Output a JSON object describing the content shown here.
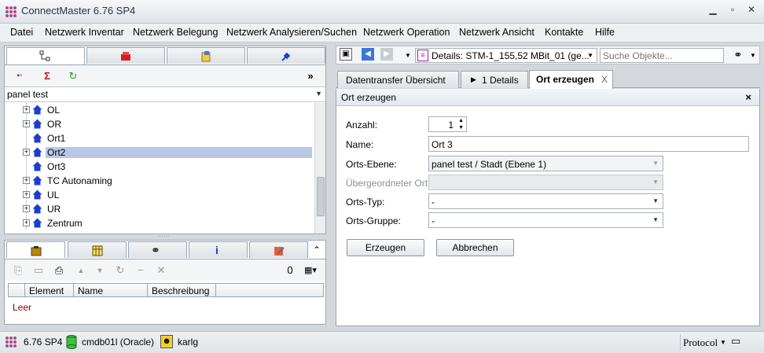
{
  "app": {
    "title": "ConnectMaster 6.76 SP4"
  },
  "menu": [
    "Datei",
    "Netzwerk Inventar",
    "Netzwerk Belegung",
    "Netzwerk Analysieren/Suchen",
    "Netzwerk Operation",
    "Netzwerk Ansicht",
    "Kontakte",
    "Hilfe"
  ],
  "left": {
    "toolbar": {
      "more": "»"
    },
    "dropdown": "panel test",
    "tree": [
      {
        "label": "OL",
        "expander": "+"
      },
      {
        "label": "OR",
        "expander": "+"
      },
      {
        "label": "Ort1",
        "expander": ""
      },
      {
        "label": "Ort2",
        "expander": "+",
        "selected": true
      },
      {
        "label": "Ort3",
        "expander": ""
      },
      {
        "label": "TC Autonaming",
        "expander": "+"
      },
      {
        "label": "UL",
        "expander": "+"
      },
      {
        "label": "UR",
        "expander": "+"
      },
      {
        "label": "Zentrum",
        "expander": "+"
      }
    ]
  },
  "bottom": {
    "count": "0",
    "columns": [
      "Element",
      "Name",
      "Beschreibung"
    ],
    "empty": "Leer"
  },
  "right": {
    "details_combo": "Details: STM-1_155,52 MBit_01  (ge...",
    "search_placeholder": "Suche Objekte...",
    "tabs": [
      {
        "label": "Datentransfer Übersicht"
      },
      {
        "label": "1 Details"
      },
      {
        "label": "Ort erzeugen"
      }
    ],
    "tab_close": "X",
    "form": {
      "title": "Ort erzeugen",
      "close": "×",
      "anzahl_label": "Anzahl:",
      "anzahl_value": "1",
      "name_label": "Name:",
      "name_value": "Ort 3",
      "ebene_label": "Orts-Ebene:",
      "ebene_value": "panel test / Stadt (Ebene 1)",
      "parent_label": "Übergeordneter Ort:",
      "parent_value": "",
      "typ_label": "Orts-Typ:",
      "typ_value": "-",
      "gruppe_label": "Orts-Gruppe:",
      "gruppe_value": "-",
      "create_button": "Erzeugen",
      "cancel_button": "Abbrechen"
    }
  },
  "status": {
    "version": "6.76 SP4",
    "db": "cmdb01l (Oracle)",
    "user": "karlg",
    "protocol": "Protocol"
  },
  "colors": {
    "selection": "#b7c8e6",
    "home_icon": "#1a3fd0",
    "empty_text": "#8b0000"
  }
}
